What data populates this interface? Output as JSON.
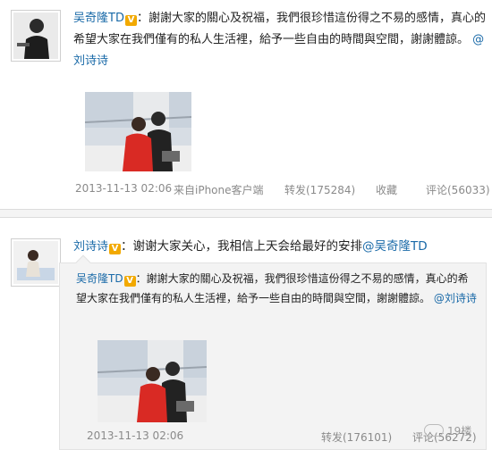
{
  "post1": {
    "author": "吴奇隆TD",
    "badge": "V",
    "text": "：謝謝大家的關心及祝福，我們很珍惜這份得之不易的感情，真心的希望大家在我們僅有的私人生活裡，給予一些自由的時間與空間，謝謝體諒。",
    "mention": "@刘诗诗",
    "timestamp": "2013-11-13 02:06",
    "source": "来自iPhone客户端",
    "repost": "转发(175284)",
    "favorite": "收藏",
    "comment": "评论(56033)"
  },
  "post2": {
    "author": "刘诗诗",
    "badge": "V",
    "text": "：谢谢大家关心，我相信上天会给最好的安排",
    "mention": "@吴奇隆TD",
    "quoted": {
      "author": "吴奇隆TD",
      "badge": "V",
      "text": "：謝謝大家的關心及祝福，我們很珍惜這份得之不易的感情，真心的希望大家在我們僅有的私人生活裡，給予一些自由的時間與空間，謝謝體諒。",
      "mention": "@刘诗诗",
      "timestamp": "2013-11-13 02:06",
      "repost": "转发(176101)",
      "comment": "评论(56272)"
    },
    "watermark": "19楼"
  },
  "colors": {
    "link": "#1a6aa8",
    "badge": "#f2a900",
    "meta": "#8a8a8a",
    "repost_bg": "#f3f3f3"
  }
}
